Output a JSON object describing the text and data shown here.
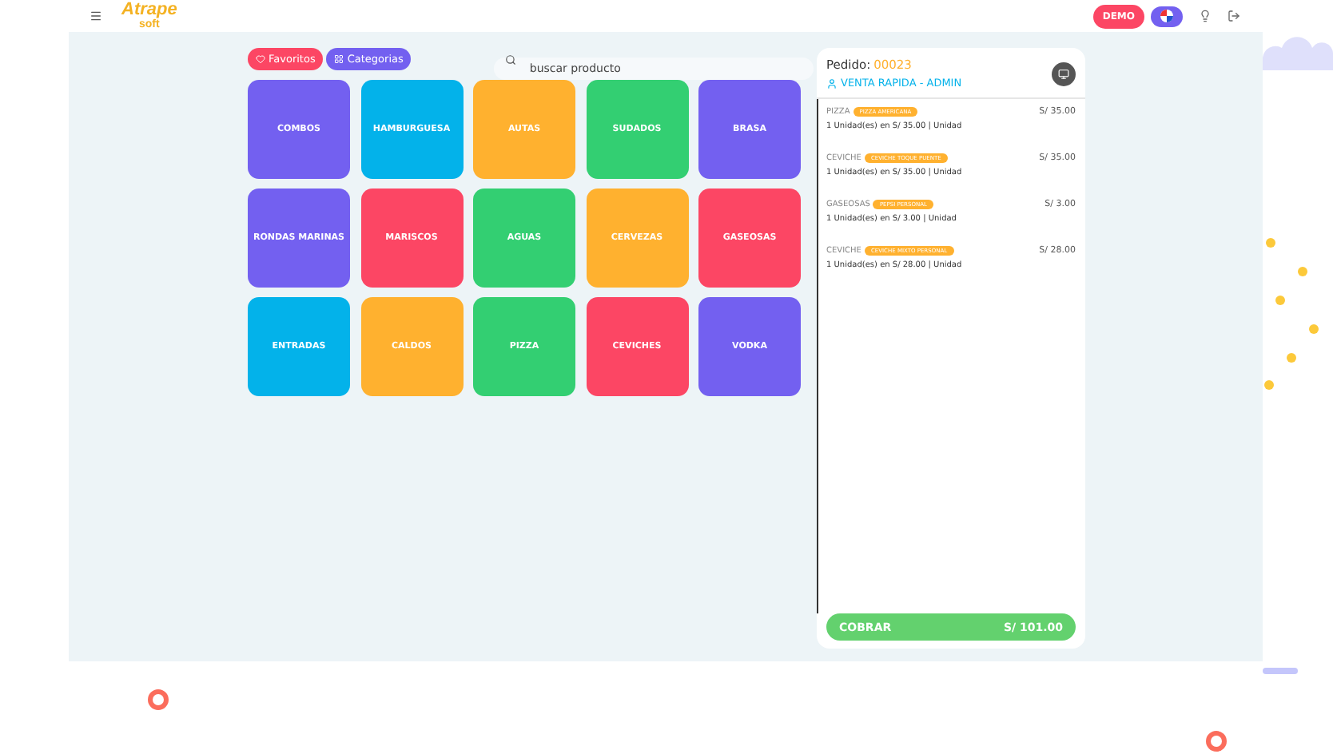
{
  "header": {
    "logo": {
      "main": "Atrape",
      "sub": "soft"
    },
    "demo_badge": "DEMO"
  },
  "filters": [
    {
      "label": "Favoritos",
      "kind": "favorites"
    },
    {
      "label": "Categorias",
      "kind": "categories"
    }
  ],
  "search": {
    "placeholder": "buscar producto"
  },
  "categories": [
    {
      "label": "COMBOS",
      "color": "#7360f0"
    },
    {
      "label": "HAMBURGUESA",
      "color": "#03b2ea"
    },
    {
      "label": "AUTAS",
      "color": "#ffb12f"
    },
    {
      "label": "SUDADOS",
      "color": "#33cf72"
    },
    {
      "label": "BRASA",
      "color": "#7360f0"
    },
    {
      "label": "RONDAS MARINAS",
      "color": "#7360f0"
    },
    {
      "label": "MARISCOS",
      "color": "#fc4664"
    },
    {
      "label": "AGUAS",
      "color": "#33cf72"
    },
    {
      "label": "CERVEZAS",
      "color": "#ffb12f"
    },
    {
      "label": "GASEOSAS",
      "color": "#fc4664"
    },
    {
      "label": "ENTRADAS",
      "color": "#03b2ea"
    },
    {
      "label": "CALDOS",
      "color": "#ffb12f"
    },
    {
      "label": "PIZZA",
      "color": "#33cf72"
    },
    {
      "label": "CEVICHES",
      "color": "#fc4664"
    },
    {
      "label": "VODKA",
      "color": "#7360f0"
    }
  ],
  "order": {
    "label": "Pedido:",
    "number": "00023",
    "customer": "VENTA RAPIDA - ADMIN",
    "items": [
      {
        "category": "PIZZA",
        "product": "PIZZA AMERICANA",
        "price": "S/ 35.00",
        "detail": "1 Unidad(es) en S/ 35.00 | Unidad"
      },
      {
        "category": "CEVICHE",
        "product": "CEVICHE TOQUE PUENTE",
        "price": "S/ 35.00",
        "detail": "1 Unidad(es) en S/ 35.00 | Unidad"
      },
      {
        "category": "GASEOSAS",
        "product": "PEPSI PERSONAL",
        "price": "S/ 3.00",
        "detail": "1 Unidad(es) en S/ 3.00 | Unidad"
      },
      {
        "category": "CEVICHE",
        "product": "CEVICHE MIXTO PERSONAL",
        "price": "S/ 28.00",
        "detail": "1 Unidad(es) en S/ 28.00 | Unidad"
      }
    ],
    "charge_label": "COBRAR",
    "total": "S/ 101.00"
  }
}
